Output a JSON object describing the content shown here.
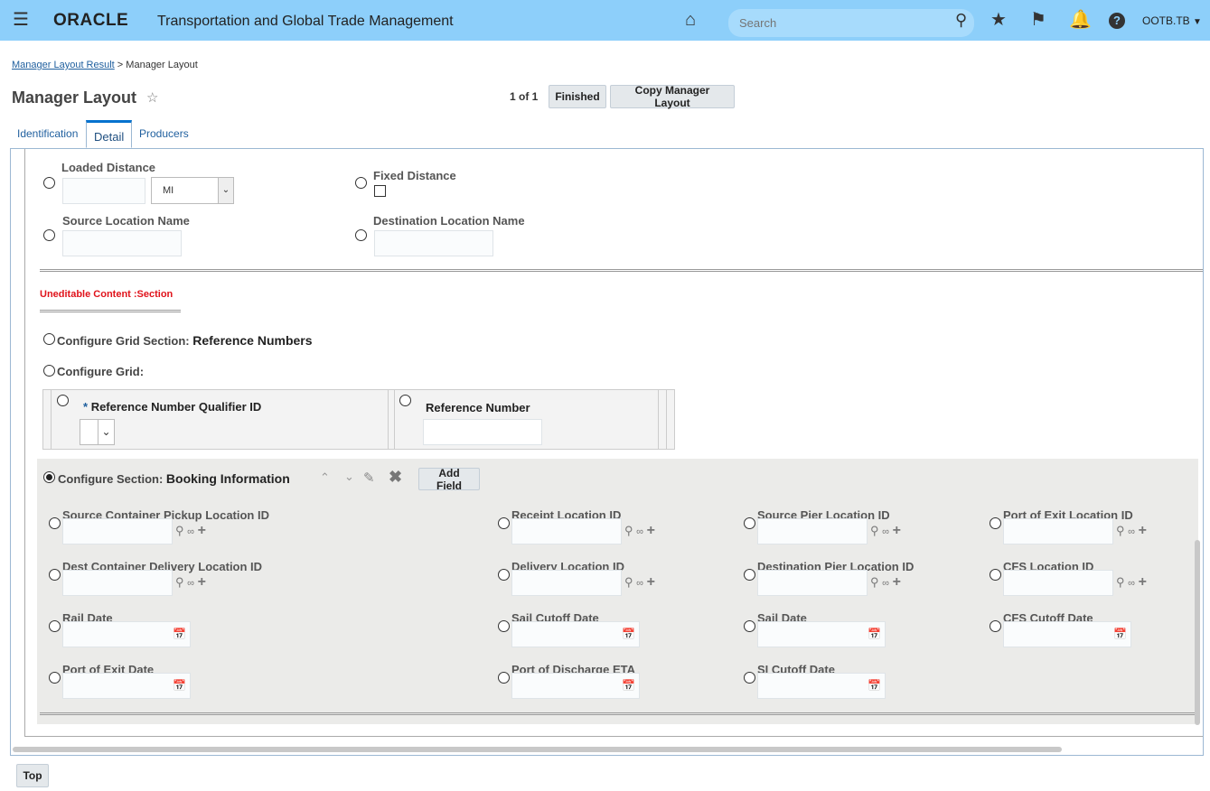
{
  "header": {
    "app_title": "Transportation and Global Trade Management",
    "logo": "ORACLE",
    "search_placeholder": "Search",
    "user": "OOTB.TB"
  },
  "breadcrumb": {
    "link": "Manager Layout Result",
    "separator": ">",
    "current": "Manager Layout"
  },
  "page": {
    "title": "Manager Layout",
    "pager": "1 of 1",
    "finished": "Finished",
    "copy": "Copy Manager Layout"
  },
  "tabs": [
    {
      "label": "Identification"
    },
    {
      "label": "Detail",
      "active": true
    },
    {
      "label": "Producers"
    }
  ],
  "top_fields": {
    "loaded_distance": "Loaded Distance",
    "uom": "MI",
    "fixed_distance": "Fixed Distance",
    "source_location_name": "Source Location Name",
    "destination_location_name": "Destination Location Name"
  },
  "uneditable": "Uneditable Content :Section",
  "grid_section": {
    "label": "Configure Grid Section:",
    "name": "Reference Numbers",
    "grid_label": "Configure Grid:",
    "col1_req": "*",
    "col1": "Reference Number Qualifier ID",
    "col2": "Reference Number"
  },
  "booking": {
    "label": "Configure Section:",
    "name": "Booking Information",
    "add_field": "Add Field",
    "fields": [
      {
        "label": "Source Container Pickup Location ID",
        "kind": "lookup"
      },
      {
        "label": "Receipt Location ID",
        "kind": "lookup"
      },
      {
        "label": "Source Pier Location ID",
        "kind": "lookup"
      },
      {
        "label": "Port of Exit Location ID",
        "kind": "lookup"
      },
      {
        "label": "Dest Container Delivery Location ID",
        "kind": "lookup"
      },
      {
        "label": "Delivery Location ID",
        "kind": "lookup"
      },
      {
        "label": "Destination Pier Location ID",
        "kind": "lookup"
      },
      {
        "label": "CFS Location ID",
        "kind": "lookup"
      },
      {
        "label": "Rail Date",
        "kind": "date"
      },
      {
        "label": "Sail Cutoff Date",
        "kind": "date"
      },
      {
        "label": "Sail Date",
        "kind": "date"
      },
      {
        "label": "CFS Cutoff Date",
        "kind": "date"
      },
      {
        "label": "Port of Exit Date",
        "kind": "date"
      },
      {
        "label": "Port of Discharge ETA",
        "kind": "date"
      },
      {
        "label": "SI Cutoff Date",
        "kind": "date"
      }
    ]
  },
  "footer": {
    "top": "Top"
  }
}
